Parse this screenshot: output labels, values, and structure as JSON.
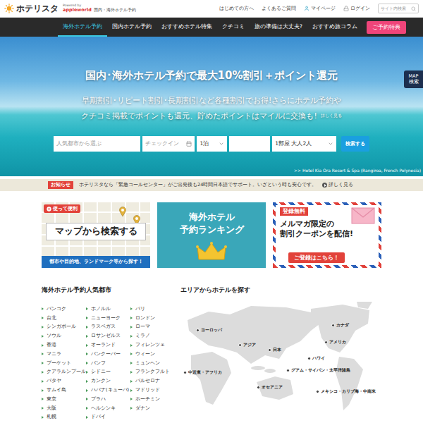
{
  "header": {
    "logo": "ホテリスタ",
    "powered": "Powered by",
    "brand": "appleworld",
    "tagline": "国内・海外ホテル予約",
    "links": [
      {
        "label": "はじめての方へ",
        "kind": "plain"
      },
      {
        "label": "よくあるご質問",
        "kind": "plain"
      },
      {
        "label": "マイページ",
        "kind": "mypage"
      },
      {
        "label": "ログイン",
        "kind": "login"
      }
    ],
    "search": {
      "placeholder": "サイト内検索"
    }
  },
  "nav": [
    {
      "label": "海外ホテル予約",
      "selected": true,
      "kind": "link"
    },
    {
      "label": "国内ホテル予約",
      "selected": false,
      "kind": "link"
    },
    {
      "label": "おすすめホテル特集",
      "selected": false,
      "kind": "link"
    },
    {
      "label": "クチコミ",
      "selected": false,
      "kind": "link"
    },
    {
      "label": "旅の準備は大丈夫?",
      "selected": false,
      "kind": "link"
    },
    {
      "label": "おすすめ旅コラム",
      "selected": false,
      "kind": "link"
    },
    {
      "label": "ご予約特典",
      "selected": false,
      "kind": "button"
    }
  ],
  "hero": {
    "title": "国内･海外ホテル予約で最大10%割引＋ポイント還元",
    "subtitle": [
      "早期割引･リピート割引･長期割引など各種割引でお得!さらにホテル予約や",
      "クチコミ掲載でポイントも還元、貯めたポイントはマイルに交換も!"
    ],
    "more": "詳しく見る",
    "search": {
      "destination": "人気都市から選ぶ",
      "checkin": "チェックイン",
      "nights": "1泊",
      "checkout": "",
      "guests": "1部屋 大人2人",
      "button": "検索する"
    },
    "caption": ">> Hotel Kia Ora Resort & Spa (Rangiroa, French Polynesia)"
  },
  "map_tab": [
    "MAP",
    "検索"
  ],
  "notice": {
    "label": "お知らせ",
    "text": "ホテリスタなら「緊急コールセンター」がご出発後も24時間日本語でサポート。いざという時も安心です。",
    "more": "詳しく見る"
  },
  "map_banner": {
    "badge": "使って便利",
    "title": "マップから検索する",
    "caption": "都市や目的地、ランドマーク等から探す！"
  },
  "ranking_banner": {
    "title": [
      "海外ホテル",
      "予約ランキング"
    ]
  },
  "mail_banner": {
    "badge": "登録無料",
    "title": [
      "メルマガ限定の",
      "割引クーポンを配信!"
    ],
    "button": "ご登録はこちら！"
  },
  "cities": {
    "title": "海外ホテル予約人気都市",
    "columns": [
      [
        "バンコク",
        "台北",
        "シンガポール",
        "ソウル",
        "香港",
        "マニラ",
        "プーケット",
        "クアラルンプール",
        "パタヤ",
        "サムイ島",
        "東京",
        "大阪",
        "札幌"
      ],
      [
        "ホノルル",
        "ニューヨーク",
        "ラスベガス",
        "ロサンゼルス",
        "オーランド",
        "バンクーバー",
        "バンフ",
        "シドニー",
        "カンクン",
        "ハバナ(キューバ)",
        "プラハ",
        "ヘルシンキ",
        "ドバイ"
      ],
      [
        "パリ",
        "ロンドン",
        "ローマ",
        "ミラノ",
        "フィレンツェ",
        "ウィーン",
        "ミュンヘン",
        "フランクフルト",
        "バルセロナ",
        "マドリッド",
        "ホーチミン",
        "ダナン"
      ]
    ]
  },
  "areas": {
    "title": "エリアからホテルを探す",
    "items": [
      "ヨーロッパ",
      "カナダ",
      "アジア",
      "日本",
      "アメリカ",
      "ハワイ",
      "グアム・サイパン・太平洋諸島",
      "中近東・アフリカ",
      "オセアニア",
      "メキシコ・カリブ海・中南米"
    ]
  }
}
